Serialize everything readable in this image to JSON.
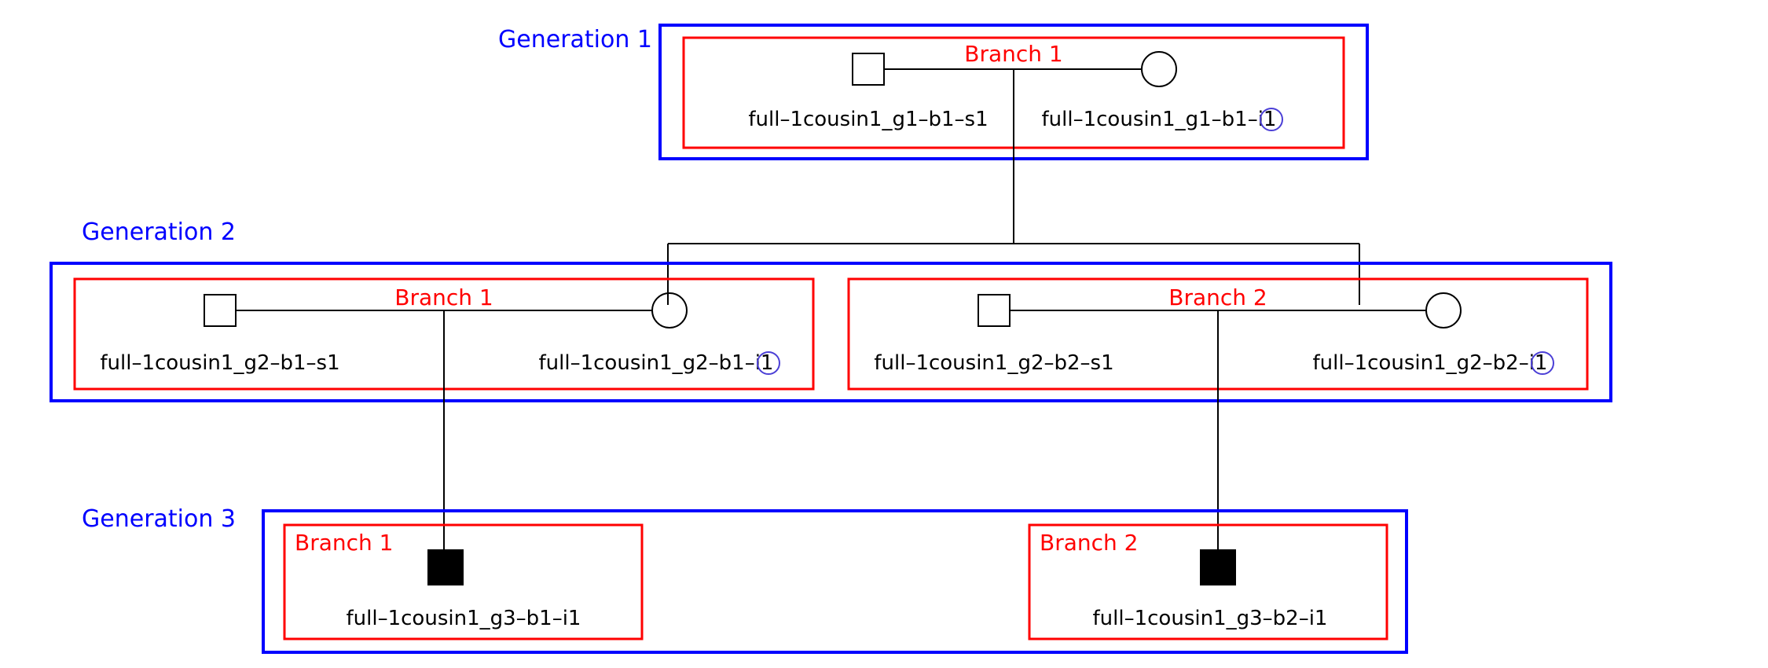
{
  "chart_data": {
    "type": "pedigree",
    "title": "",
    "generations": [
      {
        "label": "Generation 1",
        "branches": [
          {
            "label": "Branch 1",
            "individuals": [
              {
                "id": "full-1cousin1_g1-b1-s1",
                "sex": "male",
                "affected": false,
                "role": "spouse"
              },
              {
                "id": "full-1cousin1_g1-b1-i1",
                "sex": "female",
                "affected": false,
                "role": "individual",
                "marked": true
              }
            ]
          }
        ]
      },
      {
        "label": "Generation 2",
        "branches": [
          {
            "label": "Branch 1",
            "individuals": [
              {
                "id": "full-1cousin1_g2-b1-s1",
                "sex": "male",
                "affected": false,
                "role": "spouse"
              },
              {
                "id": "full-1cousin1_g2-b1-i1",
                "sex": "female",
                "affected": false,
                "role": "individual",
                "marked": true
              }
            ]
          },
          {
            "label": "Branch 2",
            "individuals": [
              {
                "id": "full-1cousin1_g2-b2-s1",
                "sex": "male",
                "affected": false,
                "role": "spouse"
              },
              {
                "id": "full-1cousin1_g2-b2-i1",
                "sex": "female",
                "affected": false,
                "role": "individual",
                "marked": true
              }
            ]
          }
        ]
      },
      {
        "label": "Generation 3",
        "branches": [
          {
            "label": "Branch 1",
            "individuals": [
              {
                "id": "full-1cousin1_g3-b1-i1",
                "sex": "male",
                "affected": true,
                "role": "individual"
              }
            ]
          },
          {
            "label": "Branch 2",
            "individuals": [
              {
                "id": "full-1cousin1_g3-b2-i1",
                "sex": "male",
                "affected": true,
                "role": "individual"
              }
            ]
          }
        ]
      }
    ],
    "relationships": [
      {
        "parents": [
          "full-1cousin1_g1-b1-s1",
          "full-1cousin1_g1-b1-i1"
        ],
        "children": [
          "full-1cousin1_g2-b1-i1",
          "full-1cousin1_g2-b2-i1"
        ]
      },
      {
        "parents": [
          "full-1cousin1_g2-b1-s1",
          "full-1cousin1_g2-b1-i1"
        ],
        "children": [
          "full-1cousin1_g3-b1-i1"
        ]
      },
      {
        "parents": [
          "full-1cousin1_g2-b2-s1",
          "full-1cousin1_g2-b2-i1"
        ],
        "children": [
          "full-1cousin1_g3-b2-i1"
        ]
      }
    ]
  },
  "labels": {
    "gen1": "Generation 1",
    "gen2": "Generation 2",
    "gen3": "Generation 3",
    "g1b1": "Branch 1",
    "g2b1": "Branch 1",
    "g2b2": "Branch 2",
    "g3b1": "Branch 1",
    "g3b2": "Branch 2",
    "g1b1s1": "full–1cousin1_g1–b1–s1",
    "g1b1i1": "full–1cousin1_g1–b1–i1",
    "g2b1s1": "full–1cousin1_g2–b1–s1",
    "g2b1i1": "full–1cousin1_g2–b1–i1",
    "g2b2s1": "full–1cousin1_g2–b2–s1",
    "g2b2i1": "full–1cousin1_g2–b2–i1",
    "g3b1i1": "full–1cousin1_g3–b1–i1",
    "g3b2i1": "full–1cousin1_g3–b2–i1"
  },
  "colors": {
    "generation_box": "#0000ff",
    "branch_box": "#ff0000",
    "affected_fill": "#000000",
    "marker_stroke": "#4b3fd6"
  }
}
